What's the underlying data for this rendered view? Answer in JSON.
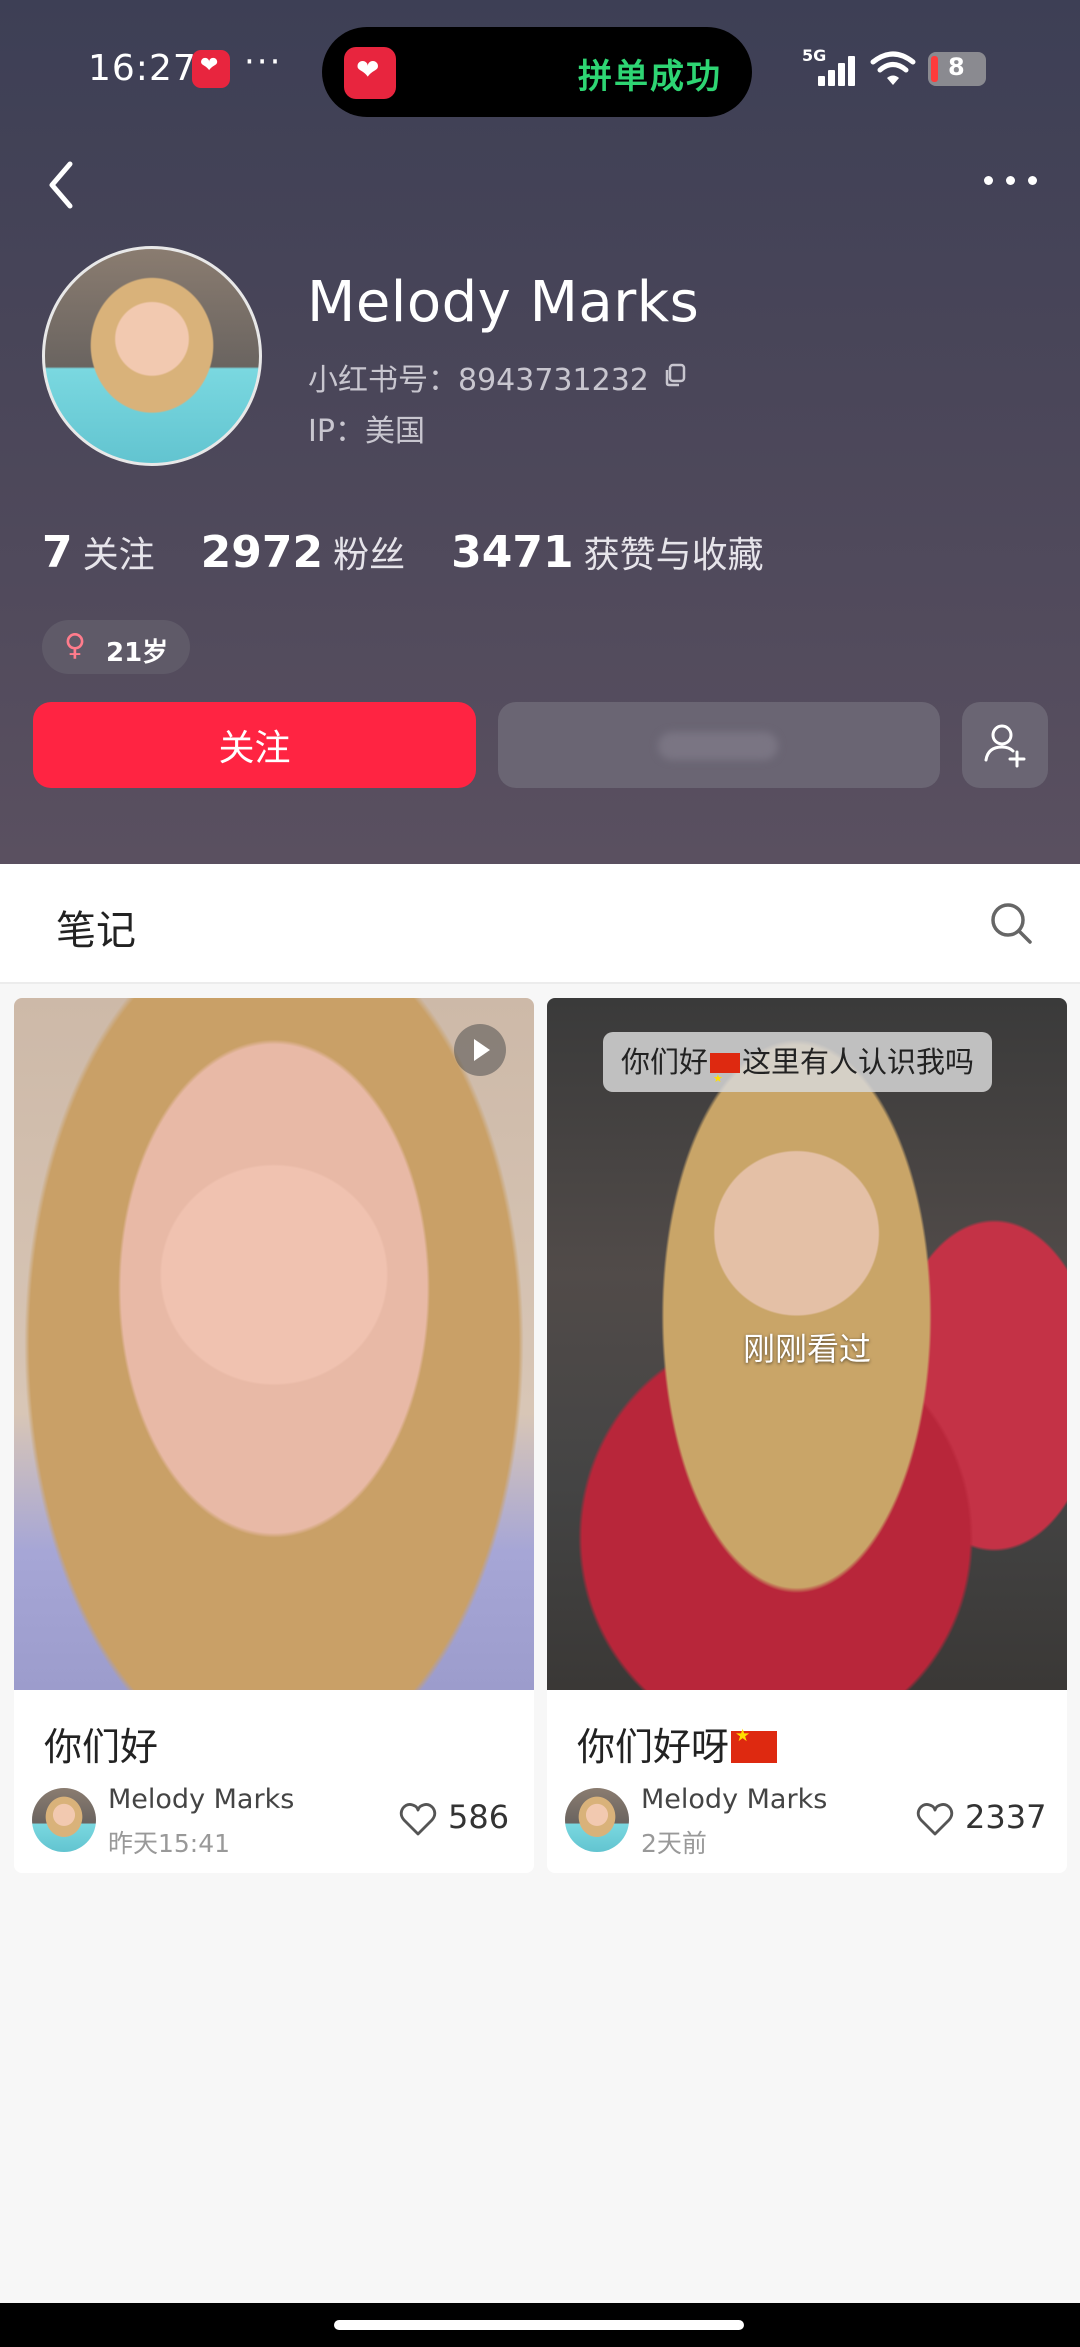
{
  "status_bar": {
    "time": "16:27",
    "dots": "···",
    "island_text": "拼单成功",
    "network": "5G",
    "battery": "8"
  },
  "profile": {
    "name": "Melody Marks",
    "red_id": "小红书号：8943731232",
    "ip": "IP：美国",
    "stats": [
      {
        "num": "7",
        "label": "关注"
      },
      {
        "num": "2972",
        "label": "粉丝"
      },
      {
        "num": "3471",
        "label": "获赞与收藏"
      }
    ],
    "age": "21岁",
    "follow_label": "关注"
  },
  "tabs": {
    "notes": "笔记"
  },
  "notes": [
    {
      "title": "你们好",
      "author": "Melody Marks",
      "time": "昨天15:41",
      "likes": "586",
      "has_video": true
    },
    {
      "title": "你们好呀",
      "caption_before": "你们好",
      "caption_after": "这里有人认识我吗",
      "seen_label": "刚刚看过",
      "author": "Melody Marks",
      "time": "2天前",
      "likes": "2337"
    }
  ],
  "colors": {
    "accent": "#ff2442",
    "header_bg": "#4a4659"
  }
}
